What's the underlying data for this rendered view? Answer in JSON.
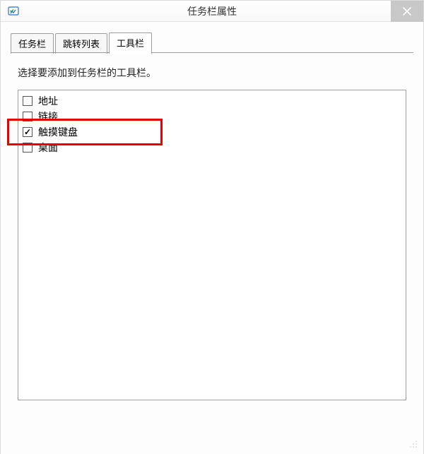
{
  "window": {
    "title": "任务栏属性",
    "close_tooltip": "关闭"
  },
  "tabs": [
    {
      "id": "taskbar",
      "label": "任务栏",
      "active": false
    },
    {
      "id": "jumplist",
      "label": "跳转列表",
      "active": false
    },
    {
      "id": "toolbars",
      "label": "工具栏",
      "active": true
    }
  ],
  "panel": {
    "instruction": "选择要添加到任务栏的工具栏。",
    "items": [
      {
        "id": "address",
        "label": "地址",
        "checked": false
      },
      {
        "id": "links",
        "label": "链接",
        "checked": false
      },
      {
        "id": "touchkbd",
        "label": "触摸键盘",
        "checked": true,
        "highlighted": true
      },
      {
        "id": "desktop",
        "label": "桌面",
        "checked": false
      }
    ]
  },
  "annotation": {
    "target_item_id": "touchkbd",
    "color": "#e60000"
  }
}
